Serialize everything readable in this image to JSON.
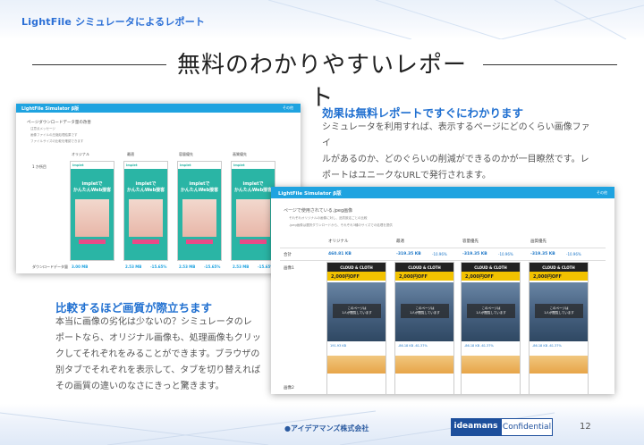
{
  "header": {
    "label": "LightFile シミュレータによるレポート"
  },
  "title": "無料のわかりやすいレポート",
  "section_right": {
    "heading": "効果は無料レポートですぐにわかります",
    "lines": [
      "シミュレータを利用すれば、表示するページにどのくらい画像ファイ",
      "ルがあるのか、どのぐらいの削減ができるのかが一目瞭然です。レ",
      "ポートはユニークなURLで発行されます。"
    ]
  },
  "section_left": {
    "heading": "比較するほど画質が際立ちます",
    "lines": [
      "本当に画像の劣化は少ないの？シミュレータのレ",
      "ポートなら、オリジナル画像も、処理画像もクリッ",
      "クしてそれぞれをみることができます。ブラウザの",
      "別タブでそれぞれを表示して、タブを切り替えれば",
      "その画質の違いのなさにきっと驚きます。"
    ]
  },
  "shot1": {
    "app_title": "LightFile Simulator β版",
    "top_right": "その他",
    "heading": "ページダウンロードデータ量の改善",
    "notes": [
      "注意点メッセージ",
      "画像ファイルの圧縮処理結果です",
      "ファイルサイズの比較を確認できます"
    ],
    "columns": [
      "オリジナル",
      "最適",
      "容量優先",
      "画質優先"
    ],
    "row_label": "1 か所目",
    "bottom_label": "ダウンロードデータ量",
    "thumb_brand": "implet",
    "thumb_text": [
      "implet",
      "で",
      "かんたんWeb接客"
    ],
    "values": [
      "3.00 MB",
      "2.53 MB",
      "-15.65%",
      "2.53 MB",
      "-15.65%",
      "2.53 MB",
      "-15.65%"
    ]
  },
  "shot2": {
    "app_title": "LightFile Simulator β版",
    "top_right": "その他",
    "heading": "ページで使用されている.jpeg画像",
    "notes": [
      "それぞれオリジナルの画像に対し、品質設定ごとの比較",
      ".jpeg画像は選択ダウンロードから、それぞれ3種のサイズでの処理を提供"
    ],
    "columns": [
      "オリジナル",
      "最適",
      "容量優先",
      "画質優先"
    ],
    "row_total": "合計",
    "row_image1": "画像1",
    "row_image2": "画像2",
    "totals": [
      "460.81 KB",
      "-319.35 KB",
      "-10.96%",
      "-319.35 KB",
      "-10.96%",
      "-319.35 KB",
      "-10.96%"
    ],
    "card_bar": "CLOUD & CLOTH",
    "card_offer": "2,000円OFF",
    "card_msg": [
      "このページは",
      "1人が閲覧しています"
    ],
    "card_foot": [
      "191.93 KB",
      "-86.18 KB",
      "-61.37%",
      "-86.18 KB",
      "-61.37%",
      "-86.18 KB",
      "-61.37%"
    ]
  },
  "footer": {
    "company": "●アイデアマンズ株式会社",
    "badge_dark": "ideamans",
    "badge_light": "Confidential",
    "page": "12"
  },
  "colors": {
    "accent": "#1f6fd0",
    "appbar": "#1fa3e0",
    "brand": "#1d4f9c"
  }
}
